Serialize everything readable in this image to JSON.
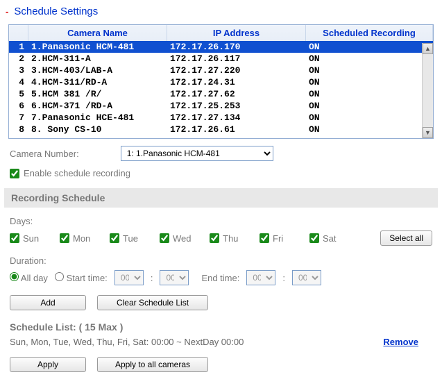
{
  "title": "Schedule Settings",
  "table": {
    "headers": {
      "name": "Camera Name",
      "ip": "IP Address",
      "rec": "Scheduled Recording"
    },
    "rows": [
      {
        "num": "1",
        "name": "1.Panasonic HCM-481",
        "ip": "172.17.26.170",
        "rec": "ON"
      },
      {
        "num": "2",
        "name": "2.HCM-311-A",
        "ip": "172.17.26.117",
        "rec": "ON"
      },
      {
        "num": "3",
        "name": "3.HCM-403/LAB-A",
        "ip": "172.17.27.220",
        "rec": "ON"
      },
      {
        "num": "4",
        "name": "4.HCM-311/RD-A",
        "ip": "172.17.24.31",
        "rec": "ON"
      },
      {
        "num": "5",
        "name": "5.HCM 381 /R/",
        "ip": "172.17.27.62",
        "rec": "ON"
      },
      {
        "num": "6",
        "name": "6.HCM-371 /RD-A",
        "ip": "172.17.25.253",
        "rec": "ON"
      },
      {
        "num": "7",
        "name": "7.Panasonic HCE-481",
        "ip": "172.17.27.134",
        "rec": "ON"
      },
      {
        "num": "8",
        "name": "8. Sony CS-10",
        "ip": "172.17.26.61",
        "rec": "ON"
      }
    ]
  },
  "camera_number": {
    "label": "Camera Number:",
    "selected": "1: 1.Panasonic HCM-481"
  },
  "enable_label": "Enable schedule recording",
  "recording_schedule_header": "Recording Schedule",
  "days": {
    "label": "Days:",
    "items": [
      "Sun",
      "Mon",
      "Tue",
      "Wed",
      "Thu",
      "Fri",
      "Sat"
    ],
    "select_all": "Select all"
  },
  "duration": {
    "label": "Duration:",
    "all_day": "All day",
    "start_time": "Start time:",
    "end_time": "End time:",
    "hh": "00",
    "mm": "00",
    "sep": ":"
  },
  "buttons": {
    "add": "Add",
    "clear": "Clear Schedule List",
    "apply": "Apply",
    "apply_all": "Apply to all cameras"
  },
  "schedule_list": {
    "title": "Schedule List: ( 15 Max )",
    "entry": "Sun, Mon, Tue, Wed, Thu, Fri, Sat: 00:00 ~ NextDay 00:00",
    "remove": "Remove"
  }
}
